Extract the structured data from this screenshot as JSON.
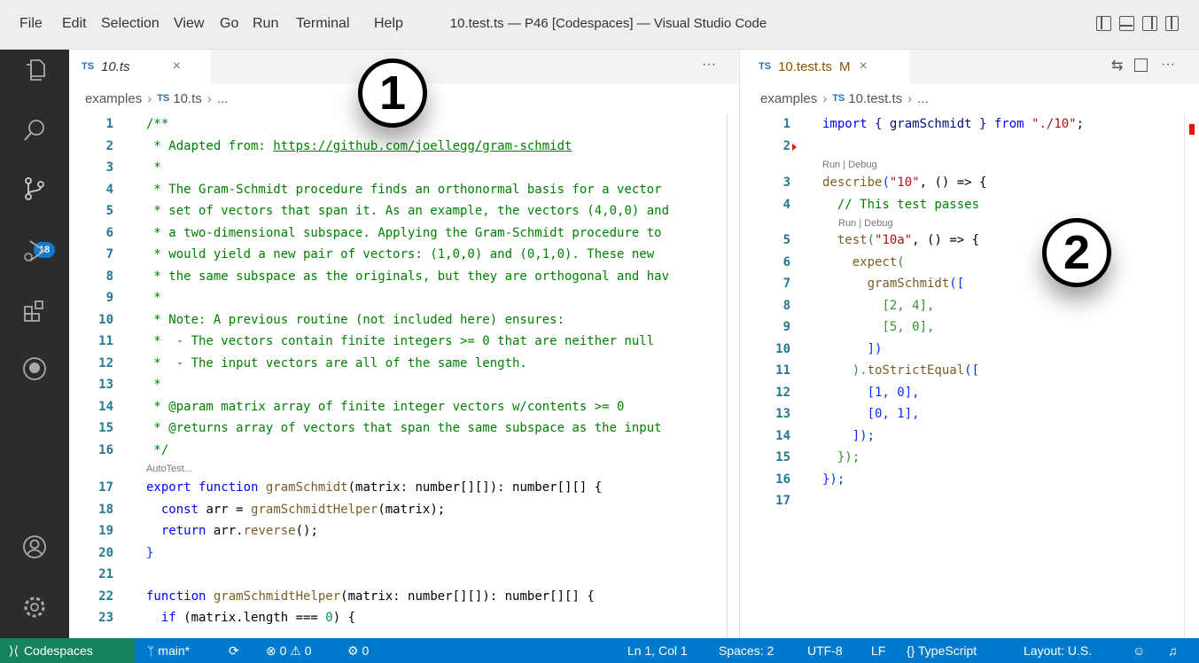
{
  "menu": [
    "File",
    "Edit",
    "Selection",
    "View",
    "Go",
    "Run",
    "Terminal",
    "Help"
  ],
  "window_title": "10.test.ts — P46 [Codespaces] — Visual Studio Code",
  "activity": {
    "scm_badge": "18"
  },
  "left": {
    "tab_label": "10.ts",
    "tab_lang": "TS",
    "tab_close": "×",
    "tab_more": "···",
    "breadcrumb": [
      "examples",
      "TS",
      "10.ts",
      "..."
    ],
    "line_numbers": [
      "1",
      "2",
      "3",
      "4",
      "5",
      "6",
      "7",
      "8",
      "9",
      "10",
      "11",
      "12",
      "13",
      "14",
      "15",
      "16",
      "17",
      "18",
      "19",
      "20",
      "21",
      "22",
      "23"
    ],
    "lens": "AutoTest...",
    "lines": [
      "/**",
      " * Adapted from: ",
      " *",
      " * The Gram-Schmidt procedure finds an orthonormal basis for a vector",
      " * set of vectors that span it. As an example, the vectors (4,0,0) and",
      " * a two-dimensional subspace. Applying the Gram-Schmidt procedure to",
      " * would yield a new pair of vectors: (1,0,0) and (0,1,0). These new",
      " * the same subspace as the originals, but they are orthogonal and hav",
      " *",
      " * Note: A previous routine (not included here) ensures:",
      " *  - The vectors contain finite integers >= 0 that are neither null",
      " *  - The input vectors are all of the same length.",
      " *",
      " * @param matrix array of finite integer vectors w/contents >= 0",
      " * @returns array of vectors that span the same subspace as the input",
      " */"
    ],
    "url": "https://github.com/joellegg/gram-schmidt",
    "code17": {
      "kw": "export function",
      "fn": "gramSchmidt",
      "rest": "(matrix: number[][]): number[][] {"
    },
    "code18": {
      "kw": "const",
      "rest": " arr = ",
      "fn": "gramSchmidtHelper",
      "args": "(matrix);"
    },
    "code19": {
      "kw": "return",
      "rest": " arr.",
      "fn": "reverse",
      "args": "();"
    },
    "code20": "}",
    "code22": {
      "kw": "function",
      "fn": "gramSchmidtHelper",
      "rest": "(matrix: number[][]): number[][] {"
    },
    "code23": {
      "kw": "if",
      "rest": " (matrix.length === ",
      "num": "0",
      "end": ") {"
    }
  },
  "right": {
    "tab_label": "10.test.ts",
    "tab_lang": "TS",
    "tab_modified": "M",
    "tab_close": "×",
    "tab_more": "···",
    "breadcrumb": [
      "examples",
      "TS",
      "10.test.ts",
      "..."
    ],
    "line_numbers": [
      "1",
      "2",
      "3",
      "4",
      "5",
      "6",
      "7",
      "8",
      "9",
      "10",
      "11",
      "12",
      "13",
      "14",
      "15",
      "16",
      "17"
    ],
    "lens_run_debug": "Run | Debug",
    "l1": {
      "kw1": "import",
      "p1": " { gramSchmidt } ",
      "kw2": "from",
      "str": "\"./10\"",
      "end": ";"
    },
    "l3": {
      "fn": "describe",
      "str": "\"10\"",
      "rest": ", () => {"
    },
    "l4": "// This test passes",
    "l5": {
      "fn": "test",
      "str": "\"10a\"",
      "rest": ", () => {"
    },
    "l6": {
      "fn": "expect",
      "end": "("
    },
    "l7": {
      "fn": "gramSchmidt",
      "end": "(["
    },
    "l8": "[2, 4],",
    "l9": "[5, 0],",
    "l10": "])",
    "l11": {
      "pre": ").",
      "fn": "toStrictEqual",
      "end": "(["
    },
    "l12": "[1, 0],",
    "l13": "[0, 1],",
    "l14": "]);",
    "l15": "});",
    "l16": "});"
  },
  "callouts": [
    "1",
    "2"
  ],
  "status": {
    "remote": "Codespaces",
    "branch": "main*",
    "problems": "⊗ 0 ⚠ 0",
    "ports": "0",
    "position": "Ln 1, Col 1",
    "spaces": "Spaces: 2",
    "encoding": "UTF-8",
    "eol": "LF",
    "language": "TypeScript",
    "layout": "Layout: U.S."
  }
}
